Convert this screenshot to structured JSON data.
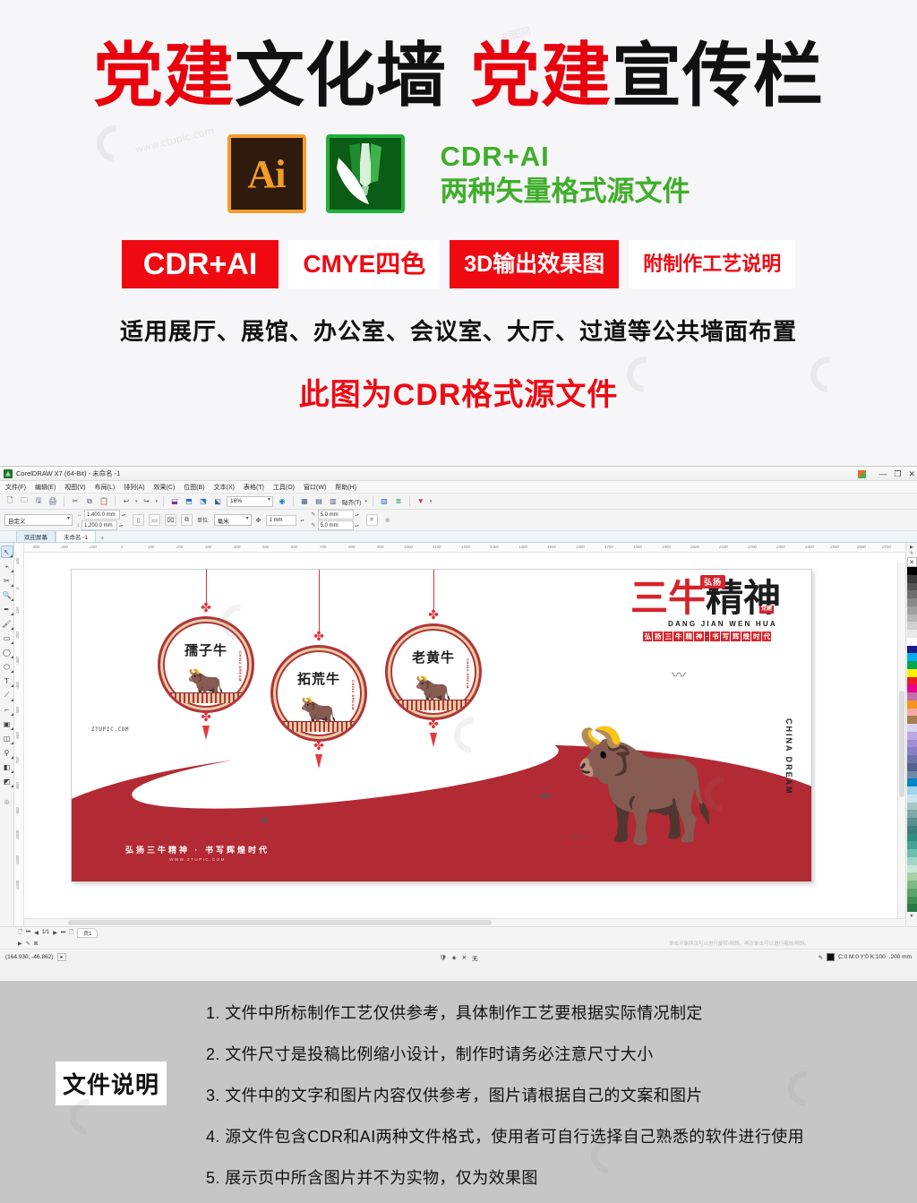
{
  "promo": {
    "title": [
      {
        "text": "党建",
        "color": "red"
      },
      {
        "text": "文化墙",
        "color": "black"
      },
      {
        "text": "党建",
        "color": "red"
      },
      {
        "text": "宣传栏",
        "color": "black"
      }
    ],
    "ai_icon_label": "Ai",
    "format_line1": "CDR+AI",
    "format_line2": "两种矢量格式源文件",
    "badges": [
      {
        "label": "CDR+AI",
        "style": "filled"
      },
      {
        "label": "CMYE四色",
        "style": "outline"
      },
      {
        "label": "3D输出效果图",
        "style": "filled"
      },
      {
        "label": "附制作工艺说明",
        "style": "outline"
      }
    ],
    "subtitle": "适用展厅、展馆、办公室、会议室、大厅、过道等公共墙面布置",
    "note": "此图为CDR格式源文件",
    "colors": {
      "red": "#ef0a12",
      "green": "#3fae2a",
      "orange": "#f59b2a",
      "black": "#111111"
    }
  },
  "watermarks": {
    "brand": "创图网",
    "url": "www.ctupic.com"
  },
  "coreldraw": {
    "window_title": "CorelDRAW X7 (64-Bit) - 未命名 -1",
    "window_buttons": [
      "—",
      "❐",
      "✕"
    ],
    "menus": [
      "文件(F)",
      "编辑(E)",
      "视图(V)",
      "布局(L)",
      "排列(A)",
      "效果(C)",
      "位图(B)",
      "文本(X)",
      "表格(T)",
      "工具(O)",
      "窗口(W)",
      "帮助(H)"
    ],
    "toolbar": {
      "icons": [
        "new-document-icon",
        "open-folder-icon",
        "save-icon",
        "print-icon",
        "cut-icon",
        "copy-icon",
        "paste-icon",
        "undo-icon",
        "redo-icon",
        "import-icon",
        "export-icon",
        "publish-pdf-icon",
        "application-launcher-icon"
      ],
      "zoom_level": "16%",
      "snap_label": "贴齐(T)",
      "options_icon": "options-icon",
      "help_icon": "help-icon"
    },
    "property_bar": {
      "preset": "自定义",
      "width": "1,400.0 mm",
      "height": "1,200.0 mm",
      "orientation_portrait_icon": "portrait-icon",
      "orientation_landscape_icon": "landscape-icon",
      "page_icon": "page-size-icon",
      "units_label": "单位:",
      "units": "毫米",
      "nudge": "1 mm",
      "bleed_a": "5.0 mm",
      "bleed_b": "5.0 mm"
    },
    "tabs": [
      {
        "label": "欢迎屏幕",
        "active": false
      },
      {
        "label": "未命名 -1",
        "active": true
      }
    ],
    "tab_add": "+",
    "toolbox": [
      "pick-tool-icon",
      "shape-tool-icon",
      "crop-tool-icon",
      "zoom-tool-icon",
      "freehand-tool-icon",
      "artistic-media-icon",
      "rectangle-tool-icon",
      "ellipse-tool-icon",
      "polygon-tool-icon",
      "text-tool-icon",
      "parallel-dimension-icon",
      "connector-tool-icon",
      "drop-shadow-icon",
      "transparency-tool-icon",
      "color-eyedropper-icon",
      "interactive-fill-icon",
      "smart-fill-icon",
      "quick-customize-icon"
    ],
    "ruler_h_ticks": [
      "-300",
      "-200",
      "-100",
      "0",
      "100",
      "200",
      "300",
      "400",
      "500",
      "600",
      "700",
      "800",
      "900",
      "1000",
      "1100",
      "1200",
      "1300",
      "1400",
      "1500",
      "1600",
      "1700",
      "1800",
      "1900",
      "2000",
      "2100",
      "2200",
      "2300",
      "2400",
      "2500",
      "2600",
      "2700"
    ],
    "ruler_v_ticks": [
      "100",
      "0",
      "-100",
      "-200",
      "-300",
      "-400",
      "-500",
      "-600",
      "-700",
      "-800",
      "-900",
      "-1000",
      "-1100",
      "-1200",
      "-1300"
    ],
    "page_nav": {
      "first": "⏮",
      "prev": "◀",
      "counter": "1/1",
      "next": "▶",
      "last": "⏭",
      "add_page_icon": "add-page-icon",
      "page_tab": "页1"
    },
    "status": {
      "coordinates": "(164.930, -46.862)",
      "hint": "单击对象两次可以进行旋转/倾斜。再次单击可以进行缩放/倾斜。",
      "fill_label": "无",
      "outline_color": "C:0 M:0 Y:0 K:100",
      "outline_width": ".200 mm"
    },
    "artwork": {
      "medallions": [
        {
          "title": "孺子牛",
          "dream": "CHINA DREAM",
          "ox": "🐂"
        },
        {
          "title": "拓荒牛",
          "dream": "CHINA DREAM",
          "ox": "🐂"
        },
        {
          "title": "老黄牛",
          "dream": "CHINA DREAM",
          "ox": "🐂"
        }
      ],
      "main_title_red": "三牛",
      "main_title_black": "精神",
      "stamp": "弘扬",
      "stamp_side": "党建",
      "pinyin": "DANG JIAN WEN HUA",
      "slogan_chars": [
        "弘",
        "扬",
        "三",
        "牛",
        "精",
        "神",
        "·",
        "书",
        "写",
        "辉",
        "煌",
        "时",
        "代"
      ],
      "china_dream": "CHINA DREAM",
      "bottom_slogan": "弘扬三牛精神 · 书写辉煌时代",
      "bottom_url": "WWW.ZTUPIC.COM",
      "corner_mark": "ZTUPIC.COM"
    }
  },
  "footer": {
    "label": "文件说明",
    "notes": [
      "1. 文件中所标制作工艺仅供参考，具体制作工艺要根据实际情况制定",
      "2. 文件尺寸是投稿比例缩小设计，制作时请务必注意尺寸大小",
      "3. 文件中的文字和图片内容仅供参考，图片请根据自己的文案和图片",
      "4. 源文件包含CDR和AI两种文件格式，使用者可自行选择自己熟悉的软件进行使用",
      "5. 展示页中所含图片并不为实物，仅为效果图"
    ]
  }
}
